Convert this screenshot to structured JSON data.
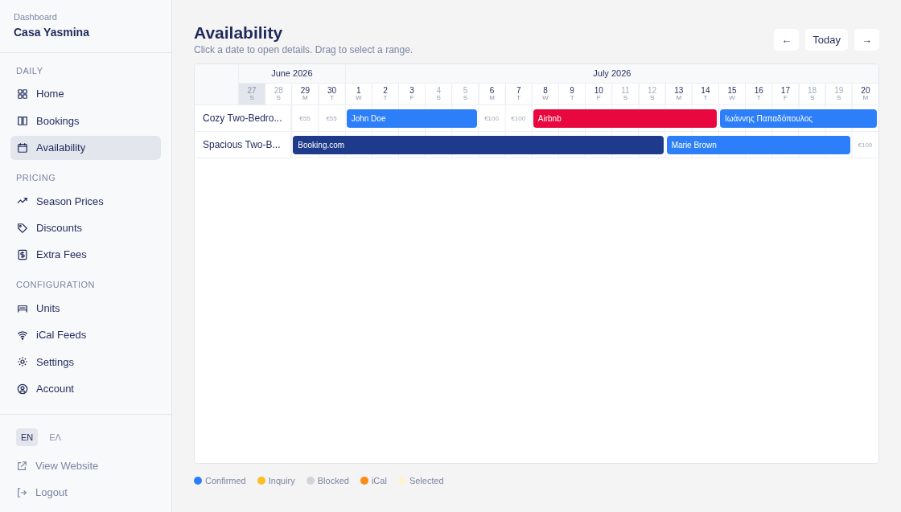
{
  "sidebar": {
    "caption": "Dashboard",
    "title": "Casa Yasmina",
    "sections": [
      {
        "label": "DAILY",
        "items": [
          {
            "label": "Home",
            "selected": false
          },
          {
            "label": "Bookings",
            "selected": false
          },
          {
            "label": "Availability",
            "selected": true
          }
        ]
      },
      {
        "label": "PRICING",
        "items": [
          {
            "label": "Season Prices",
            "selected": false
          },
          {
            "label": "Discounts",
            "selected": false
          },
          {
            "label": "Extra Fees",
            "selected": false
          }
        ]
      },
      {
        "label": "CONFIGURATION",
        "items": [
          {
            "label": "Units",
            "selected": false
          },
          {
            "label": "iCal Feeds",
            "selected": false
          },
          {
            "label": "Settings",
            "selected": false
          },
          {
            "label": "Account",
            "selected": false
          }
        ]
      }
    ],
    "languages": [
      {
        "label": "EN",
        "selected": true
      },
      {
        "label": "ΕΛ",
        "selected": false
      }
    ],
    "links": [
      {
        "label": "View Website"
      },
      {
        "label": "Logout"
      }
    ]
  },
  "page": {
    "title": "Availability",
    "subtitle": "Click a date to open details. Drag to select a range.",
    "nav": [
      {
        "label": "←"
      },
      {
        "label": "Today"
      },
      {
        "label": "→"
      }
    ]
  },
  "calendar": {
    "months": [
      {
        "label": "June 2026",
        "days": [
          {
            "day": "27",
            "weekday": "S",
            "weekend": true,
            "selected": true
          },
          {
            "day": "28",
            "weekday": "S",
            "weekend": true,
            "selected": false
          },
          {
            "day": "29",
            "weekday": "M",
            "weekend": false,
            "selected": false
          },
          {
            "day": "30",
            "weekday": "T",
            "weekend": false,
            "selected": false
          }
        ]
      },
      {
        "label": "July 2026",
        "days": [
          {
            "day": "1",
            "weekday": "W",
            "weekend": false,
            "selected": false
          },
          {
            "day": "2",
            "weekday": "T",
            "weekend": false,
            "selected": false
          },
          {
            "day": "3",
            "weekday": "F",
            "weekend": false,
            "selected": false
          },
          {
            "day": "4",
            "weekday": "S",
            "weekend": true,
            "selected": false
          },
          {
            "day": "5",
            "weekday": "S",
            "weekend": true,
            "selected": false
          },
          {
            "day": "6",
            "weekday": "M",
            "weekend": false,
            "selected": false
          },
          {
            "day": "7",
            "weekday": "T",
            "weekend": false,
            "selected": false
          },
          {
            "day": "8",
            "weekday": "W",
            "weekend": false,
            "selected": false
          },
          {
            "day": "9",
            "weekday": "T",
            "weekend": false,
            "selected": false
          },
          {
            "day": "10",
            "weekday": "F",
            "weekend": false,
            "selected": false
          },
          {
            "day": "11",
            "weekday": "S",
            "weekend": true,
            "selected": false
          },
          {
            "day": "12",
            "weekday": "S",
            "weekend": true,
            "selected": false
          },
          {
            "day": "13",
            "weekday": "M",
            "weekend": false,
            "selected": false
          },
          {
            "day": "14",
            "weekday": "T",
            "weekend": false,
            "selected": false
          },
          {
            "day": "15",
            "weekday": "W",
            "weekend": false,
            "selected": false
          },
          {
            "day": "16",
            "weekday": "T",
            "weekend": false,
            "selected": false
          },
          {
            "day": "17",
            "weekday": "F",
            "weekend": false,
            "selected": false
          },
          {
            "day": "18",
            "weekday": "S",
            "weekend": true,
            "selected": false
          },
          {
            "day": "19",
            "weekday": "S",
            "weekend": true,
            "selected": false
          },
          {
            "day": "20",
            "weekday": "M",
            "weekend": false,
            "selected": false
          }
        ]
      }
    ],
    "units": [
      {
        "name": "Cozy Two-Bedro...",
        "cells": [
          {
            "kind": "price",
            "text": "€55"
          },
          {
            "kind": "price",
            "text": "€55"
          },
          {
            "kind": "booking",
            "label": "John Doe",
            "color": "#2d7ff9"
          },
          {
            "kind": "night"
          },
          {
            "kind": "night"
          },
          {
            "kind": "night"
          },
          {
            "kind": "night"
          },
          {
            "kind": "price",
            "text": "€100"
          },
          {
            "kind": "price",
            "text": "€100"
          },
          {
            "kind": "booking",
            "label": "Airbnb",
            "color": "#e8073f"
          },
          {
            "kind": "night"
          },
          {
            "kind": "night"
          },
          {
            "kind": "night"
          },
          {
            "kind": "night"
          },
          {
            "kind": "night"
          },
          {
            "kind": "night"
          },
          {
            "kind": "booking",
            "label": "Ιωάννης Παπαδόπουλος",
            "color": "#2d7ff9"
          },
          {
            "kind": "night"
          },
          {
            "kind": "night"
          },
          {
            "kind": "night"
          },
          {
            "kind": "night"
          },
          {
            "kind": "night"
          }
        ]
      },
      {
        "name": "Spacious Two-B...",
        "cells": [
          {
            "kind": "booking",
            "label": "Booking.com",
            "color": "#1e3a8a"
          },
          {
            "kind": "night"
          },
          {
            "kind": "night"
          },
          {
            "kind": "night"
          },
          {
            "kind": "night"
          },
          {
            "kind": "night"
          },
          {
            "kind": "night"
          },
          {
            "kind": "night"
          },
          {
            "kind": "night"
          },
          {
            "kind": "night"
          },
          {
            "kind": "night"
          },
          {
            "kind": "night"
          },
          {
            "kind": "night"
          },
          {
            "kind": "night"
          },
          {
            "kind": "booking",
            "label": "Marie Brown",
            "color": "#2d7ff9"
          },
          {
            "kind": "night"
          },
          {
            "kind": "night"
          },
          {
            "kind": "night"
          },
          {
            "kind": "night"
          },
          {
            "kind": "night"
          },
          {
            "kind": "night"
          },
          {
            "kind": "price",
            "text": "€109"
          }
        ]
      }
    ]
  },
  "legend": [
    {
      "label": "Confirmed",
      "color": "#2d7ff9"
    },
    {
      "label": "Inquiry",
      "color": "#fbbf24"
    },
    {
      "label": "Blocked",
      "color": "#d4d4d8"
    },
    {
      "label": "iCal",
      "color": "#fb8c14"
    },
    {
      "label": "Selected",
      "color": "#fdf3d0"
    }
  ]
}
